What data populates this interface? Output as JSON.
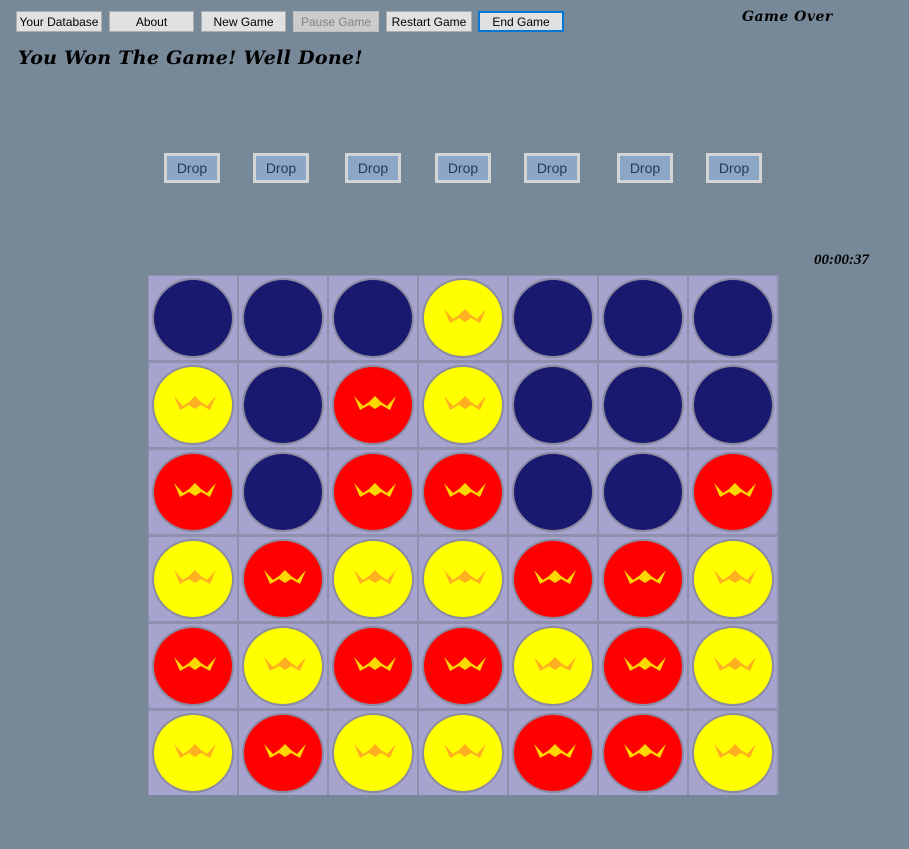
{
  "toolbar": {
    "your_database": "Your Database",
    "about": "About",
    "new_game": "New Game",
    "pause_game": "Pause Game",
    "restart_game": "Restart Game",
    "end_game": "End Game"
  },
  "status": {
    "title": "Game Over",
    "message": "You Won The Game! Well Done!",
    "timer": "00:00:37"
  },
  "drop_labels": [
    "Drop",
    "Drop",
    "Drop",
    "Drop",
    "Drop",
    "Drop",
    "Drop"
  ],
  "colors": {
    "background": "#778899",
    "empty": "#191970",
    "yellow": "#ffff00",
    "red": "#ff0000",
    "cell": "#a6a4cf",
    "crown_on_yellow": "#ffb020",
    "crown_on_red": "#ffd700"
  },
  "board": [
    [
      "empty",
      "empty",
      "empty",
      "yellow",
      "empty",
      "empty",
      "empty"
    ],
    [
      "yellow",
      "empty",
      "red",
      "yellow",
      "empty",
      "empty",
      "empty"
    ],
    [
      "red",
      "empty",
      "red",
      "red",
      "empty",
      "empty",
      "red"
    ],
    [
      "yellow",
      "red",
      "yellow",
      "yellow",
      "red",
      "red",
      "yellow"
    ],
    [
      "red",
      "yellow",
      "red",
      "red",
      "yellow",
      "red",
      "yellow"
    ],
    [
      "yellow",
      "red",
      "yellow",
      "yellow",
      "red",
      "red",
      "yellow"
    ]
  ]
}
